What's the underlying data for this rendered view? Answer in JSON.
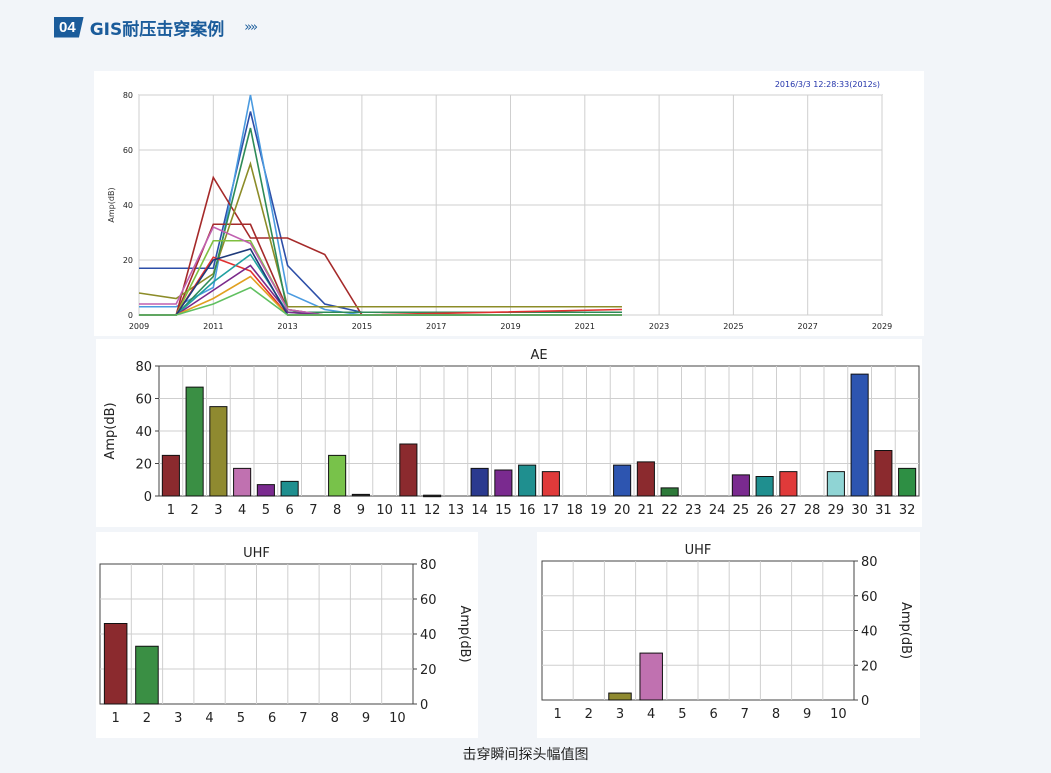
{
  "header": {
    "badge": "04",
    "title": "GIS耐压击穿案例",
    "arrows": "»»"
  },
  "caption": "击穿瞬间探头幅值图",
  "chart_data": [
    {
      "id": "trend",
      "type": "line",
      "timestamp": "2016/3/3 12:28:33(2012s)",
      "ylabel": "Amp(dB)",
      "xlim": [
        2009,
        2029
      ],
      "ylim": [
        0,
        80
      ],
      "x_ticks": [
        "2009",
        "2011",
        "2013",
        "2015",
        "2017",
        "2019",
        "2021",
        "2023",
        "2025",
        "2027",
        "2029"
      ],
      "y_ticks": [
        "0",
        "20",
        "40",
        "60",
        "80"
      ],
      "grid": true,
      "x": [
        2009,
        2010,
        2011,
        2012,
        2013,
        2014,
        2015,
        2022
      ],
      "series": [
        {
          "color": "#2d4fa8",
          "values": [
            17,
            17,
            17,
            74,
            18,
            4,
            1,
            1
          ]
        },
        {
          "color": "#4b9be0",
          "values": [
            3,
            3,
            10,
            80,
            8,
            2,
            0,
            0
          ]
        },
        {
          "color": "#a52a2a",
          "values": [
            0,
            0,
            50,
            28,
            28,
            22,
            0,
            0
          ]
        },
        {
          "color": "#a52a2a",
          "values": [
            0,
            0,
            33,
            33,
            2,
            0,
            0,
            0
          ]
        },
        {
          "color": "#8c8c28",
          "values": [
            8,
            6,
            15,
            55,
            3,
            3,
            3,
            3
          ]
        },
        {
          "color": "#2e8b57",
          "values": [
            0,
            0,
            14,
            68,
            1,
            1,
            1,
            1
          ]
        },
        {
          "color": "#7fbf3f",
          "values": [
            0,
            0,
            27,
            27,
            2,
            0,
            0,
            0
          ]
        },
        {
          "color": "#c060b0",
          "values": [
            4,
            4,
            32,
            26,
            2,
            0,
            0,
            0
          ]
        },
        {
          "color": "#e03030",
          "values": [
            0,
            0,
            21,
            16,
            0,
            0,
            0,
            2
          ]
        },
        {
          "color": "#20a0a0",
          "values": [
            0,
            0,
            12,
            22,
            1,
            0,
            0,
            0
          ]
        },
        {
          "color": "#7a2a8a",
          "values": [
            0,
            0,
            9,
            18,
            1,
            0,
            0,
            0
          ]
        },
        {
          "color": "#e0a020",
          "values": [
            0,
            0,
            6,
            14,
            0,
            0,
            0,
            0
          ]
        },
        {
          "color": "#1f3a7a",
          "values": [
            0,
            0,
            20,
            24,
            0,
            0,
            0,
            0
          ]
        },
        {
          "color": "#60c060",
          "values": [
            0,
            0,
            4,
            10,
            0,
            0,
            0,
            0
          ]
        }
      ]
    },
    {
      "id": "ae",
      "type": "bar",
      "title": "AE",
      "ylabel": "Amp(dB)",
      "ylim": [
        0,
        80
      ],
      "y_ticks": [
        "0",
        "20",
        "40",
        "60",
        "80"
      ],
      "grid": true,
      "categories": [
        "1",
        "2",
        "3",
        "4",
        "5",
        "6",
        "7",
        "8",
        "9",
        "10",
        "11",
        "12",
        "13",
        "14",
        "15",
        "16",
        "17",
        "18",
        "19",
        "20",
        "21",
        "22",
        "23",
        "24",
        "25",
        "26",
        "27",
        "28",
        "29",
        "30",
        "31",
        "32"
      ],
      "values": [
        25,
        67,
        55,
        17,
        7,
        9,
        0,
        25,
        1,
        0,
        32,
        0.5,
        0,
        17,
        16,
        19,
        15,
        0,
        0,
        19,
        21,
        5,
        0,
        0,
        13,
        12,
        15,
        0,
        15,
        75,
        28,
        17
      ],
      "colors": [
        "#8b2a2e",
        "#3a8f44",
        "#8f8a30",
        "#c071b0",
        "#7a2a8f",
        "#1f8f8f",
        "#888888",
        "#78c24a",
        "#333333",
        "#888888",
        "#8b2a2e",
        "#333333",
        "#888888",
        "#2b3a8f",
        "#7a2a8f",
        "#1f8f8f",
        "#e03a3a",
        "#888888",
        "#888888",
        "#2d55b0",
        "#8b2a2e",
        "#2e7a3a",
        "#888888",
        "#888888",
        "#7a2a8f",
        "#1f8f8f",
        "#e03a3a",
        "#888888",
        "#8fd4d4",
        "#2d55b0",
        "#8b2a2e",
        "#2e8f44"
      ]
    },
    {
      "id": "uhf1",
      "type": "bar",
      "title": "UHF",
      "ylabel": "Amp(dB)",
      "ylim": [
        0,
        80
      ],
      "y_ticks": [
        "0",
        "20",
        "40",
        "60",
        "80"
      ],
      "grid": true,
      "legend": "none",
      "categories": [
        "1",
        "2",
        "3",
        "4",
        "5",
        "6",
        "7",
        "8",
        "9",
        "10"
      ],
      "values": [
        46,
        33,
        0,
        0,
        0,
        0,
        0,
        0,
        0,
        0
      ],
      "colors": [
        "#8b2a2e",
        "#3a8f44",
        "#888888",
        "#888888",
        "#888888",
        "#888888",
        "#888888",
        "#888888",
        "#888888",
        "#888888"
      ]
    },
    {
      "id": "uhf2",
      "type": "bar",
      "title": "UHF",
      "ylabel": "Amp(dB)",
      "ylim": [
        0,
        80
      ],
      "y_ticks": [
        "0",
        "20",
        "40",
        "60",
        "80"
      ],
      "grid": true,
      "categories": [
        "1",
        "2",
        "3",
        "4",
        "5",
        "6",
        "7",
        "8",
        "9",
        "10"
      ],
      "values": [
        0,
        0,
        4,
        27,
        0,
        0,
        0,
        0,
        0,
        0
      ],
      "colors": [
        "#888888",
        "#888888",
        "#8f8a30",
        "#c071b0",
        "#888888",
        "#888888",
        "#888888",
        "#888888",
        "#888888",
        "#888888"
      ]
    }
  ]
}
